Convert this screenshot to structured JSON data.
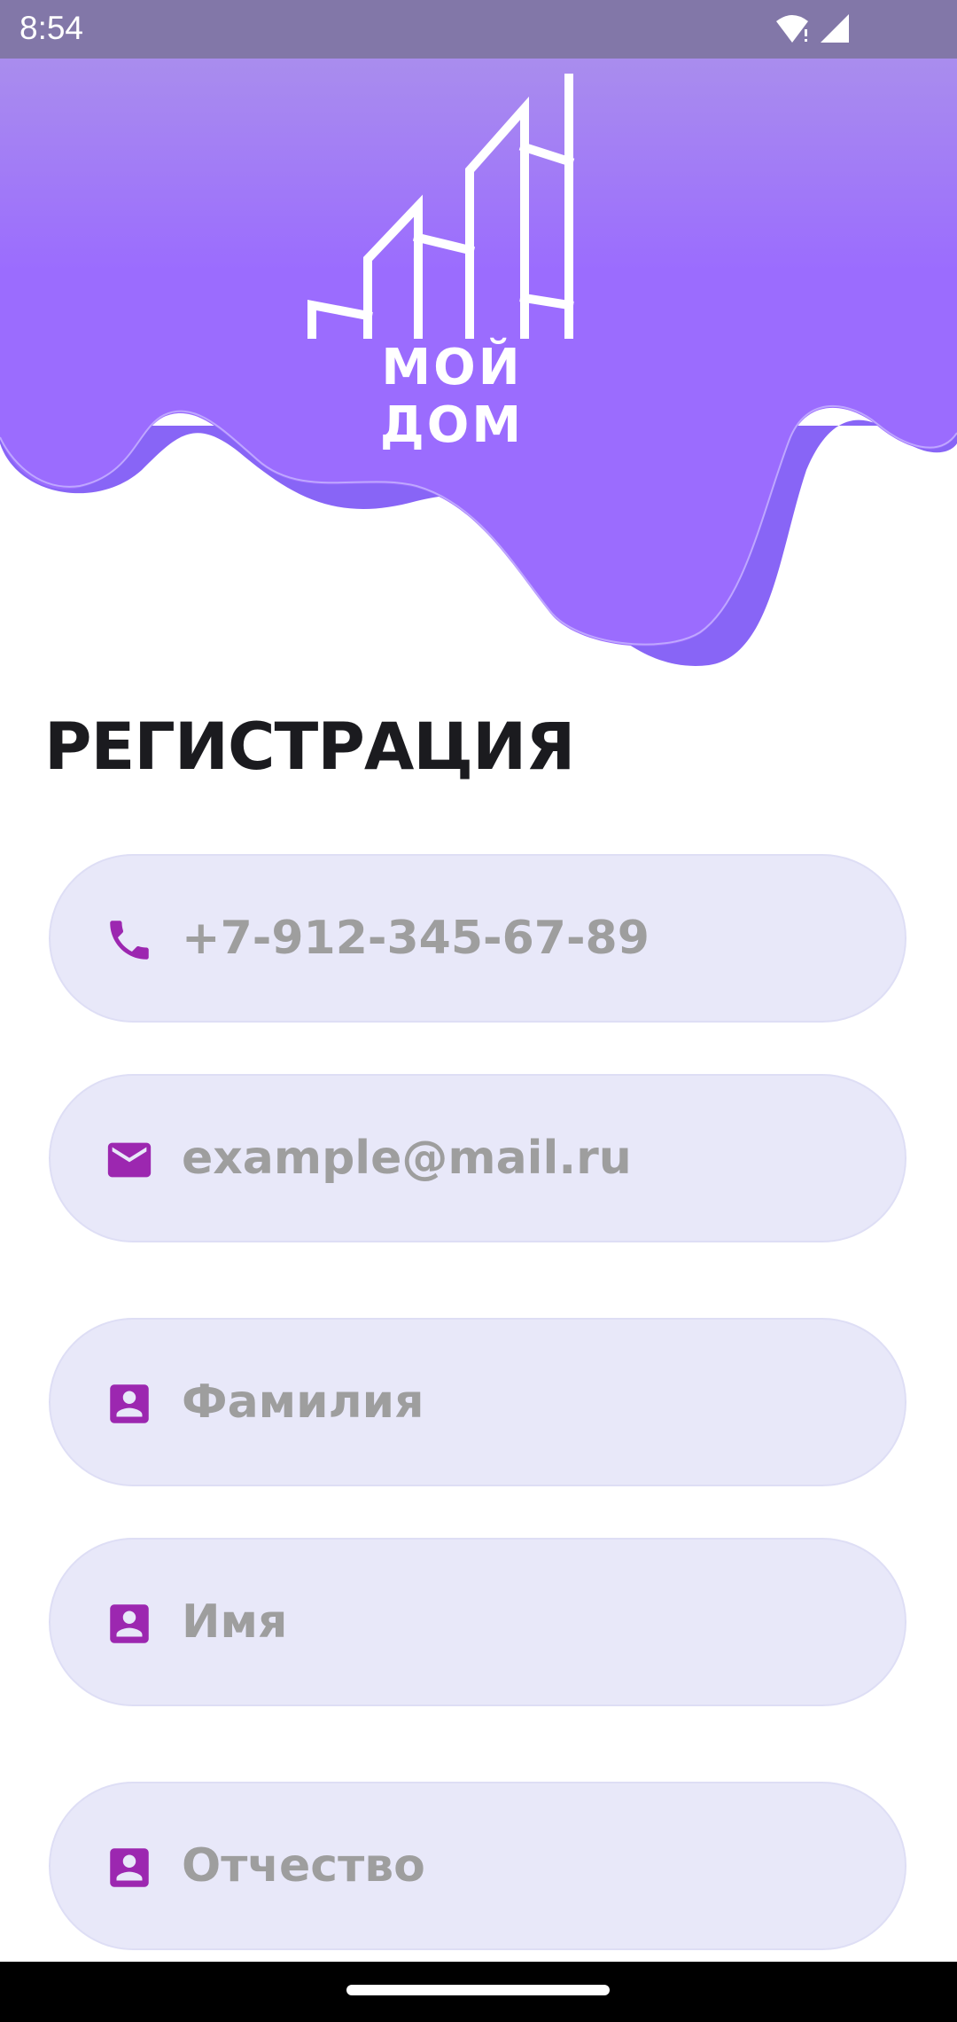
{
  "status_bar": {
    "time": "8:54",
    "icons": [
      "wifi-alert-icon",
      "cell-signal-icon"
    ]
  },
  "header": {
    "logo_text": "МОЙ ДОМ",
    "colors": {
      "gradient_top": "#ad96e9",
      "gradient_mid": "#9b6cfe",
      "wave_shadow": "#8865f6"
    }
  },
  "page": {
    "title": "РЕГИСТРАЦИЯ"
  },
  "form": {
    "fields": [
      {
        "name": "phone",
        "placeholder": "+7-912-345-67-89",
        "icon": "phone-icon"
      },
      {
        "name": "email",
        "placeholder": "example@mail.ru",
        "icon": "mail-icon"
      },
      {
        "name": "surname",
        "placeholder": "Фамилия",
        "icon": "contact-icon"
      },
      {
        "name": "first_name",
        "placeholder": "Имя",
        "icon": "contact-icon"
      },
      {
        "name": "patronymic",
        "placeholder": "Отчество",
        "icon": "contact-icon"
      }
    ],
    "colors": {
      "field_bg": "#e8e8f9",
      "icon": "#9c27b0",
      "placeholder": "#9e9e9e"
    }
  }
}
